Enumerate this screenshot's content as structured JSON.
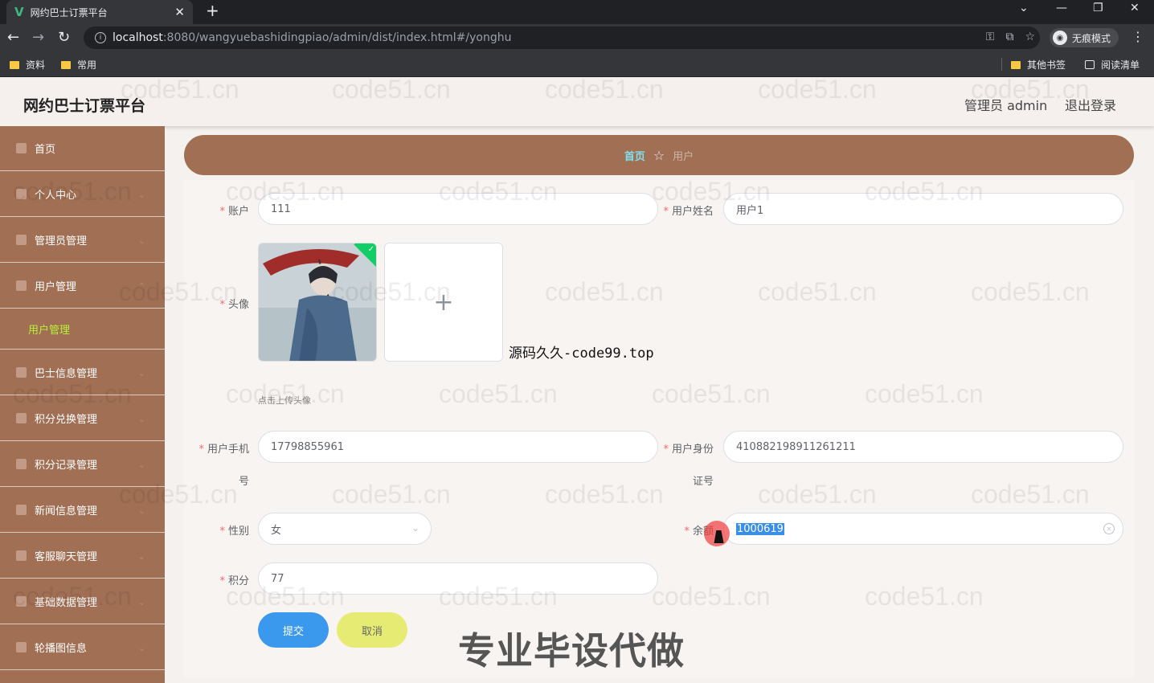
{
  "browser": {
    "tab_title": "网约巴士订票平台",
    "url_host": "localhost",
    "url_rest": ":8080/wangyuebashidingpiao/admin/dist/index.html#/yonghu",
    "incognito_label": "无痕模式",
    "bookmarks": [
      "资料",
      "常用"
    ],
    "other_bookmarks": "其他书签",
    "reading_list": "阅读清单"
  },
  "header": {
    "title": "网约巴士订票平台",
    "admin": "管理员 admin",
    "logout": "退出登录"
  },
  "sidebar": {
    "items": [
      "首页",
      "个人中心",
      "管理员管理",
      "用户管理",
      "巴士信息管理",
      "积分兑换管理",
      "积分记录管理",
      "新闻信息管理",
      "客服聊天管理",
      "基础数据管理",
      "轮播图信息"
    ],
    "sub_item": "用户管理"
  },
  "breadcrumb": {
    "home": "首页",
    "current": "用户"
  },
  "form": {
    "account": {
      "label": "账户",
      "value": "111"
    },
    "username": {
      "label": "用户姓名",
      "value": "用户1"
    },
    "avatar": {
      "label": "头像",
      "tip": "点击上传头像"
    },
    "phone": {
      "label_1": "用户手机",
      "label_2": "号",
      "value": "17798855961"
    },
    "idcard": {
      "label_1": "用户身份",
      "label_2": "证号",
      "value": "410882198911261211"
    },
    "gender": {
      "label": "性别",
      "value": "女"
    },
    "balance": {
      "label": "余额",
      "value": "1000619"
    },
    "points": {
      "label": "积分",
      "value": "77"
    },
    "submit": "提交",
    "cancel": "取消"
  },
  "overlay": {
    "source_text": "源码久久-code99.top",
    "promo_text": "专业毕设代做",
    "watermark": "code51.cn"
  }
}
